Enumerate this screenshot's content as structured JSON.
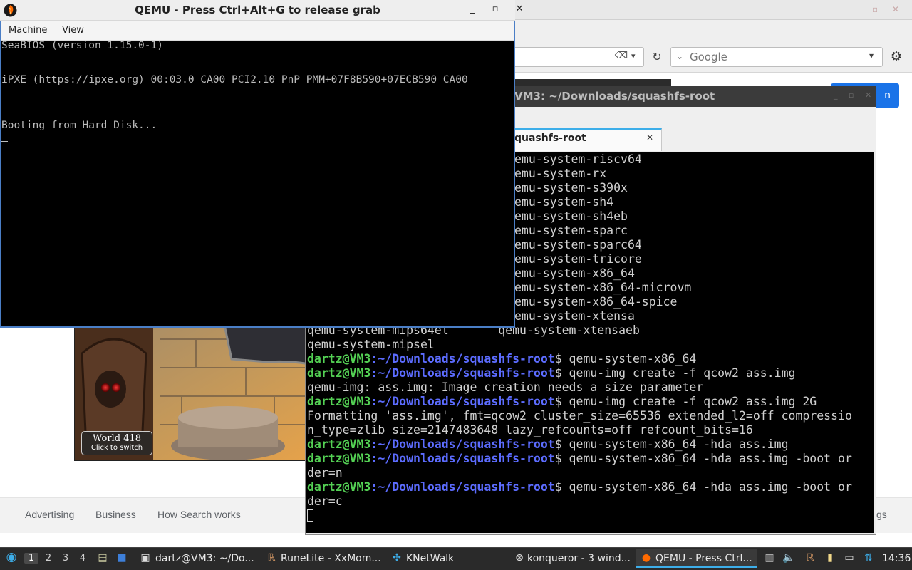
{
  "browser": {
    "window_controls": "_ ▫ ✕",
    "search_engine": "Google",
    "search_button_label": "n",
    "footer_links": [
      "Advertising",
      "Business",
      "How Search works"
    ],
    "footer_right_text": "gs"
  },
  "game_image": {
    "badge_title": "World 418",
    "badge_subtitle": "Click to switch"
  },
  "terminal": {
    "title": "VM3: ~/Downloads/squashfs-root",
    "tab_label": "quashfs-root",
    "prompt_user": "dartz@VM3",
    "prompt_path": ":~/Downloads/squashfs-root",
    "plain_lines": [
      "emu-system-riscv64",
      "emu-system-rx",
      "emu-system-s390x",
      "emu-system-sh4",
      "emu-system-sh4eb",
      "emu-system-sparc",
      "emu-system-sparc64",
      "emu-system-tricore",
      "emu-system-x86_64",
      "emu-system-x86_64-microvm",
      "emu-system-x86_64-spice",
      "emu-system-xtensa",
      "qemu-system-mips64el       qemu-system-xtensaeb",
      "qemu-system-mipsel"
    ],
    "history": [
      {
        "type": "cmd",
        "text": "$ qemu-system-x86_64"
      },
      {
        "type": "cmd",
        "text": "$ qemu-img create -f qcow2 ass.img"
      },
      {
        "type": "out",
        "text": "qemu-img: ass.img: Image creation needs a size parameter"
      },
      {
        "type": "cmd",
        "text": "$ qemu-img create -f qcow2 ass.img 2G"
      },
      {
        "type": "out",
        "text": "Formatting 'ass.img', fmt=qcow2 cluster_size=65536 extended_l2=off compressio"
      },
      {
        "type": "out",
        "text": "n_type=zlib size=2147483648 lazy_refcounts=off refcount_bits=16"
      },
      {
        "type": "cmd",
        "text": "$ qemu-system-x86_64 -hda ass.img"
      },
      {
        "type": "cmd",
        "text": "$ qemu-system-x86_64 -hda ass.img -boot or"
      },
      {
        "type": "out",
        "text": "der=n"
      },
      {
        "type": "cmd",
        "text": "$ qemu-system-x86_64 -hda ass.img -boot or"
      },
      {
        "type": "out",
        "text": "der=c"
      }
    ]
  },
  "qemu": {
    "title": "QEMU - Press Ctrl+Alt+G to release grab",
    "window_controls": "_ ▫ ✕",
    "menu": [
      "Machine",
      "View"
    ],
    "screen_lines": [
      "SeaBIOS (version 1.15.0-1)",
      "iPXE (https://ipxe.org) 00:03.0 CA00 PCI2.10 PnP PMM+07F8B590+07ECB590 CA00",
      "Booting from Hard Disk..."
    ]
  },
  "taskbar": {
    "workspaces": [
      "1",
      "2",
      "3",
      "4"
    ],
    "active_workspace": "1",
    "tasks": [
      {
        "label": "dartz@VM3: ~/Do...",
        "icon": "terminal-icon"
      },
      {
        "label": "RuneLite - XxMom...",
        "icon": "runelite-icon"
      },
      {
        "label": "KNetWalk",
        "icon": "knetwalk-icon"
      },
      {
        "label": "konqueror - 3 wind...",
        "icon": "browser-icon"
      },
      {
        "label": "QEMU - Press Ctrl...",
        "icon": "qemu-icon",
        "active": true
      }
    ],
    "clock": "14:36"
  },
  "colors": {
    "prompt_user": "#54d154",
    "prompt_path": "#5c6cff",
    "accent": "#3daee9",
    "search_button": "#1a73e8"
  }
}
